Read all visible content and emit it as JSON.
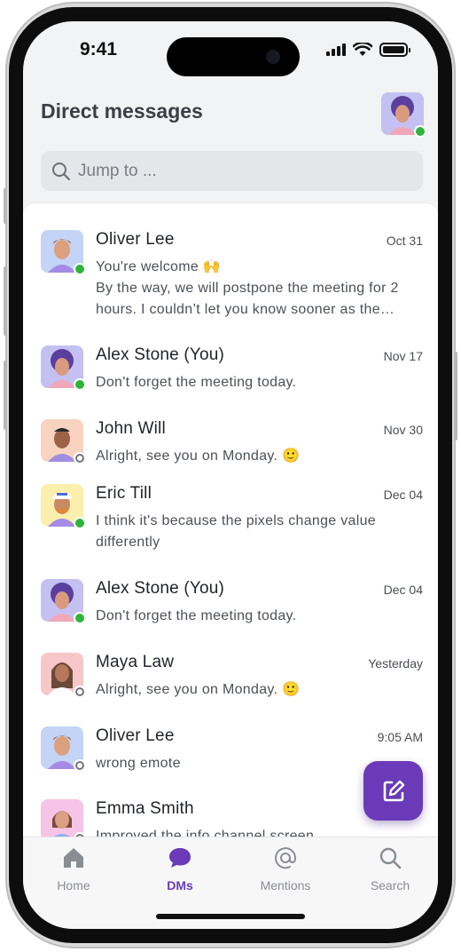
{
  "status_bar": {
    "time": "9:41"
  },
  "header": {
    "title": "Direct messages",
    "search_placeholder": "Jump to ..."
  },
  "conversations": [
    {
      "name": "Oliver Lee",
      "date": "Oct 31",
      "message": "You're welcome 🙌",
      "message2": "By the way, we will postpone the meeting for 2 hours. I couldn’t let you know sooner as the…",
      "presence": "online",
      "avatar": "oliver"
    },
    {
      "name": "Alex Stone (You)",
      "date": "Nov 17",
      "message": "Don't forget the meeting today.",
      "presence": "online",
      "avatar": "alex"
    },
    {
      "name": "John Will",
      "date": "Nov 30",
      "message": "Alright, see you on Monday. 🙂",
      "presence": "away",
      "avatar": "john"
    },
    {
      "name": "Eric Till",
      "date": "Dec 04",
      "message": "I think it's because the pixels change value differently",
      "presence": "online",
      "avatar": "eric"
    },
    {
      "name": "Alex Stone (You)",
      "date": "Dec 04",
      "message": "Don't forget the meeting today.",
      "presence": "online",
      "avatar": "alex"
    },
    {
      "name": "Maya Law",
      "date": "Yesterday",
      "message": "Alright, see you on Monday. 🙂",
      "presence": "away",
      "avatar": "maya"
    },
    {
      "name": "Oliver Lee",
      "date": "9:05 AM",
      "message": "wrong emote",
      "presence": "away",
      "avatar": "oliver"
    },
    {
      "name": "Emma Smith",
      "date": "",
      "message": "Improved the info channel screen",
      "presence": "away",
      "avatar": "emma"
    }
  ],
  "bottom_nav": [
    {
      "label": "Home",
      "icon": "home-icon",
      "active": false
    },
    {
      "label": "DMs",
      "icon": "chat-bubble-icon",
      "active": true
    },
    {
      "label": "Mentions",
      "icon": "at-icon",
      "active": false
    },
    {
      "label": "Search",
      "icon": "search-icon",
      "active": false
    }
  ],
  "colors": {
    "accent": "#6a3ab8",
    "online": "#2eb43a",
    "away": "#6d6f73"
  }
}
